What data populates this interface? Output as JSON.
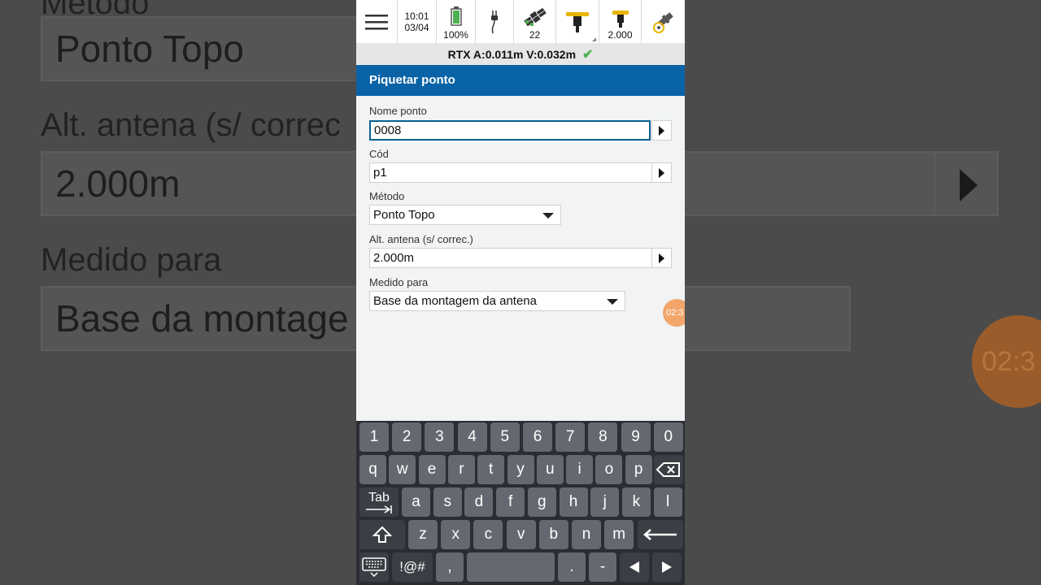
{
  "background": {
    "partial_label_top": "Método",
    "method_value": "Ponto Topo",
    "antenna_label": "Alt. antena (s/ correc",
    "antenna_value": "2.000m",
    "measured_label": "Medido para",
    "measured_value": "Base da montage",
    "timer_text": "02:3"
  },
  "statusbar": {
    "time": "10:01",
    "date": "03/04",
    "battery": "100%",
    "satellites": "22",
    "antenna_height": "2.000"
  },
  "rtx": {
    "text": "RTX A:0.011m V:0.032m"
  },
  "title": "Piquetar ponto",
  "form": {
    "point_name_label": "Nome ponto",
    "point_name_value": "0008",
    "code_label": "Cód",
    "code_value": "p1",
    "method_label": "Método",
    "method_value": "Ponto Topo",
    "antenna_label": "Alt. antena (s/ correc.)",
    "antenna_value": "2.000m",
    "measured_label": "Medido para",
    "measured_value": "Base da montagem da antena"
  },
  "timer": "02:3",
  "keyboard": {
    "row1": [
      "1",
      "2",
      "3",
      "4",
      "5",
      "6",
      "7",
      "8",
      "9",
      "0"
    ],
    "row2": [
      "q",
      "w",
      "e",
      "r",
      "t",
      "y",
      "u",
      "i",
      "o",
      "p"
    ],
    "row3_tab": "Tab",
    "row3": [
      "a",
      "s",
      "d",
      "f",
      "g",
      "h",
      "j",
      "k",
      "l"
    ],
    "row4": [
      "z",
      "x",
      "c",
      "v",
      "b",
      "n",
      "m"
    ],
    "symbols": "!@#",
    "comma": ",",
    "period": ".",
    "dash": "-"
  },
  "colors": {
    "title_bar": "#0a63a6",
    "check": "#4caf50",
    "timer": "#f3a56a",
    "keyboard_bg": "#2a2d33"
  }
}
